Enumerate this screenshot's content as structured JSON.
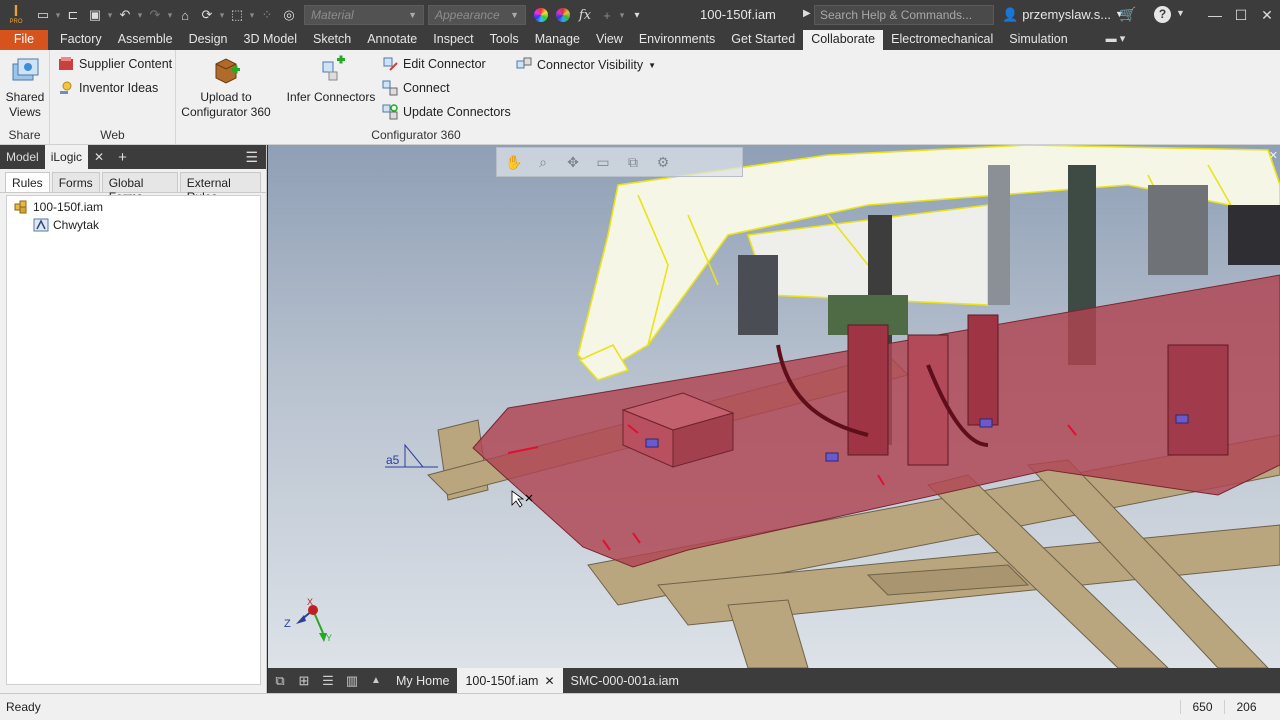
{
  "titlebar": {
    "app_logo": "I",
    "app_badge": "PRO",
    "material_placeholder": "Material",
    "appearance_placeholder": "Appearance",
    "fx_label": "fx",
    "document_title": "100-150f.iam",
    "search_placeholder": "Search Help & Commands...",
    "user_name": "przemyslaw.s..."
  },
  "ribbon_tabs": [
    {
      "label": "File"
    },
    {
      "label": "Factory"
    },
    {
      "label": "Assemble"
    },
    {
      "label": "Design"
    },
    {
      "label": "3D Model"
    },
    {
      "label": "Sketch"
    },
    {
      "label": "Annotate"
    },
    {
      "label": "Inspect"
    },
    {
      "label": "Tools"
    },
    {
      "label": "Manage"
    },
    {
      "label": "View"
    },
    {
      "label": "Environments"
    },
    {
      "label": "Get Started"
    },
    {
      "label": "Collaborate"
    },
    {
      "label": "Electromechanical"
    },
    {
      "label": "Simulation"
    }
  ],
  "ribbon": {
    "share": {
      "title": "Share",
      "shared_views": "Shared\nViews"
    },
    "web": {
      "title": "Web",
      "supplier_content": "Supplier Content",
      "inventor_ideas": "Inventor Ideas"
    },
    "configurator": {
      "title": "Configurator 360",
      "upload": "Upload to\nConfigurator 360",
      "infer": "Infer Connectors",
      "edit_connector": "Edit Connector",
      "connect": "Connect",
      "update_connectors": "Update Connectors",
      "connector_visibility": "Connector Visibility"
    }
  },
  "browser": {
    "tabs_top": [
      {
        "label": "Model"
      },
      {
        "label": "iLogic"
      }
    ],
    "subtabs": [
      {
        "label": "Rules"
      },
      {
        "label": "Forms"
      },
      {
        "label": "Global Forms"
      },
      {
        "label": "External Rules"
      }
    ],
    "tree": [
      {
        "label": "100-150f.iam"
      },
      {
        "label": "Chwytak"
      }
    ]
  },
  "viewport": {
    "annotation": "a5",
    "axis_x": "X",
    "axis_y": "Y",
    "axis_z": "Z"
  },
  "doctabs": [
    {
      "label": "My Home"
    },
    {
      "label": "100-150f.iam"
    },
    {
      "label": "SMC-000-001a.iam"
    }
  ],
  "status": {
    "text": "Ready",
    "x": "650",
    "y": "206"
  },
  "colors": {
    "file_tab": "#d6531d",
    "dark_chrome": "#3c3c3c",
    "ribbon_bg": "#f0f0f0",
    "plate_red": "#b04452",
    "frame_tan": "#b9a67e",
    "highlight_yellow": "#f2ee2a"
  }
}
